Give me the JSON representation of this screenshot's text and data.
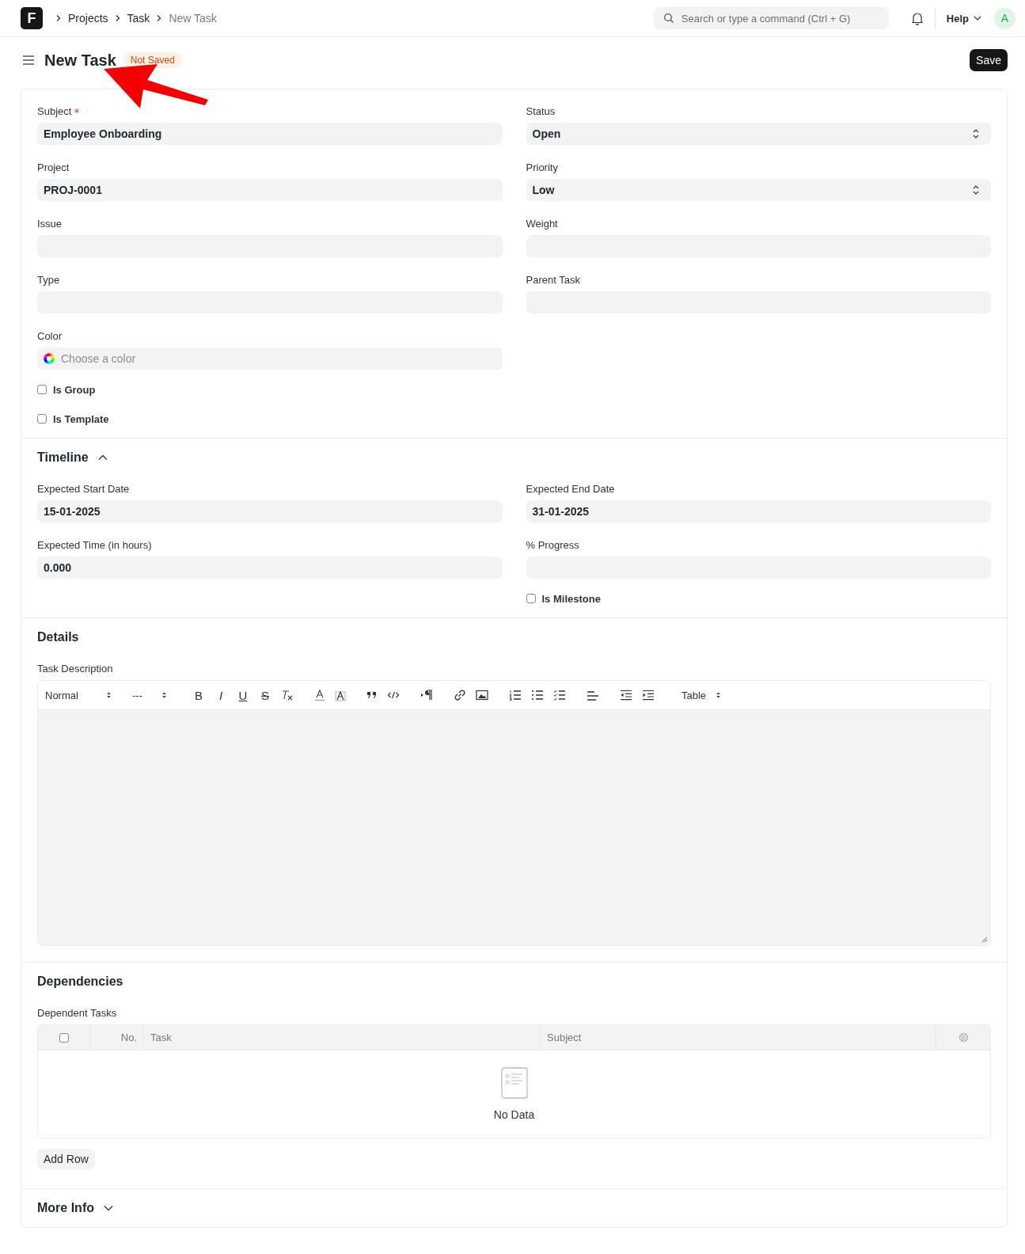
{
  "topbar": {
    "logo": "F",
    "breadcrumbs": [
      {
        "label": "Projects",
        "current": false
      },
      {
        "label": "Task",
        "current": false
      },
      {
        "label": "New Task",
        "current": true
      }
    ],
    "search": {
      "placeholder": "Search or type a command (Ctrl + G)"
    },
    "help": "Help",
    "avatar": "A"
  },
  "page": {
    "title": "New Task",
    "status": "Not Saved",
    "save": "Save",
    "annotation": true
  },
  "main": {
    "left": [
      {
        "kind": "text",
        "label": "Subject",
        "required": true,
        "value": "Employee Onboarding"
      },
      {
        "kind": "text",
        "label": "Project",
        "value": "PROJ-0001"
      },
      {
        "kind": "text",
        "label": "Issue"
      },
      {
        "kind": "text",
        "label": "Type"
      },
      {
        "kind": "color",
        "label": "Color",
        "placeholder": "Choose a color"
      },
      {
        "kind": "checkbox",
        "label": "Is Group",
        "checked": false
      },
      {
        "kind": "checkbox",
        "label": "Is Template",
        "checked": false
      }
    ],
    "right": [
      {
        "kind": "select",
        "label": "Status",
        "value": "Open"
      },
      {
        "kind": "select",
        "label": "Priority",
        "value": "Low"
      },
      {
        "kind": "text",
        "label": "Weight"
      },
      {
        "kind": "text",
        "label": "Parent Task"
      }
    ]
  },
  "timeline": {
    "title": "Timeline",
    "expanded": true,
    "left": [
      {
        "kind": "text",
        "label": "Expected Start Date",
        "value": "15-01-2025"
      },
      {
        "kind": "text",
        "label": "Expected Time (in hours)",
        "value": "0.000"
      }
    ],
    "right": [
      {
        "kind": "text",
        "label": "Expected End Date",
        "value": "31-01-2025"
      },
      {
        "kind": "text",
        "label": "% Progress"
      },
      {
        "kind": "checkbox",
        "label": "Is Milestone",
        "checked": false
      }
    ]
  },
  "details": {
    "title": "Details",
    "label": "Task Description",
    "toolbar": {
      "start_selects": [
        "Normal",
        "---"
      ],
      "format_glyphs": [
        "B",
        "I",
        "U",
        "S"
      ],
      "end_select": "Table"
    }
  },
  "dependencies": {
    "title": "Dependencies",
    "label": "Dependent Tasks",
    "columns": [
      "No.",
      "Task",
      "Subject"
    ],
    "select_all": false,
    "empty": "No Data",
    "add_row": "Add Row"
  },
  "more_info": {
    "title": "More Info",
    "expanded": false
  }
}
